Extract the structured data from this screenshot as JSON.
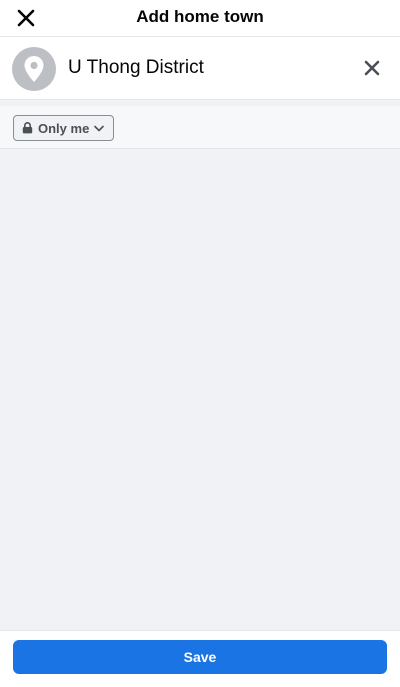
{
  "header": {
    "title": "Add home town",
    "close_icon": "close-icon"
  },
  "location": {
    "name": "U Thong District",
    "icon": "map-pin-icon",
    "clear_icon": "close-icon"
  },
  "privacy": {
    "label": "Only me",
    "icon": "lock-icon",
    "dropdown_icon": "chevron-down-icon"
  },
  "footer": {
    "save_label": "Save"
  },
  "colors": {
    "accent": "#1b74e4",
    "background": "#f0f2f5",
    "pin_avatar": "#bcc0c4"
  }
}
